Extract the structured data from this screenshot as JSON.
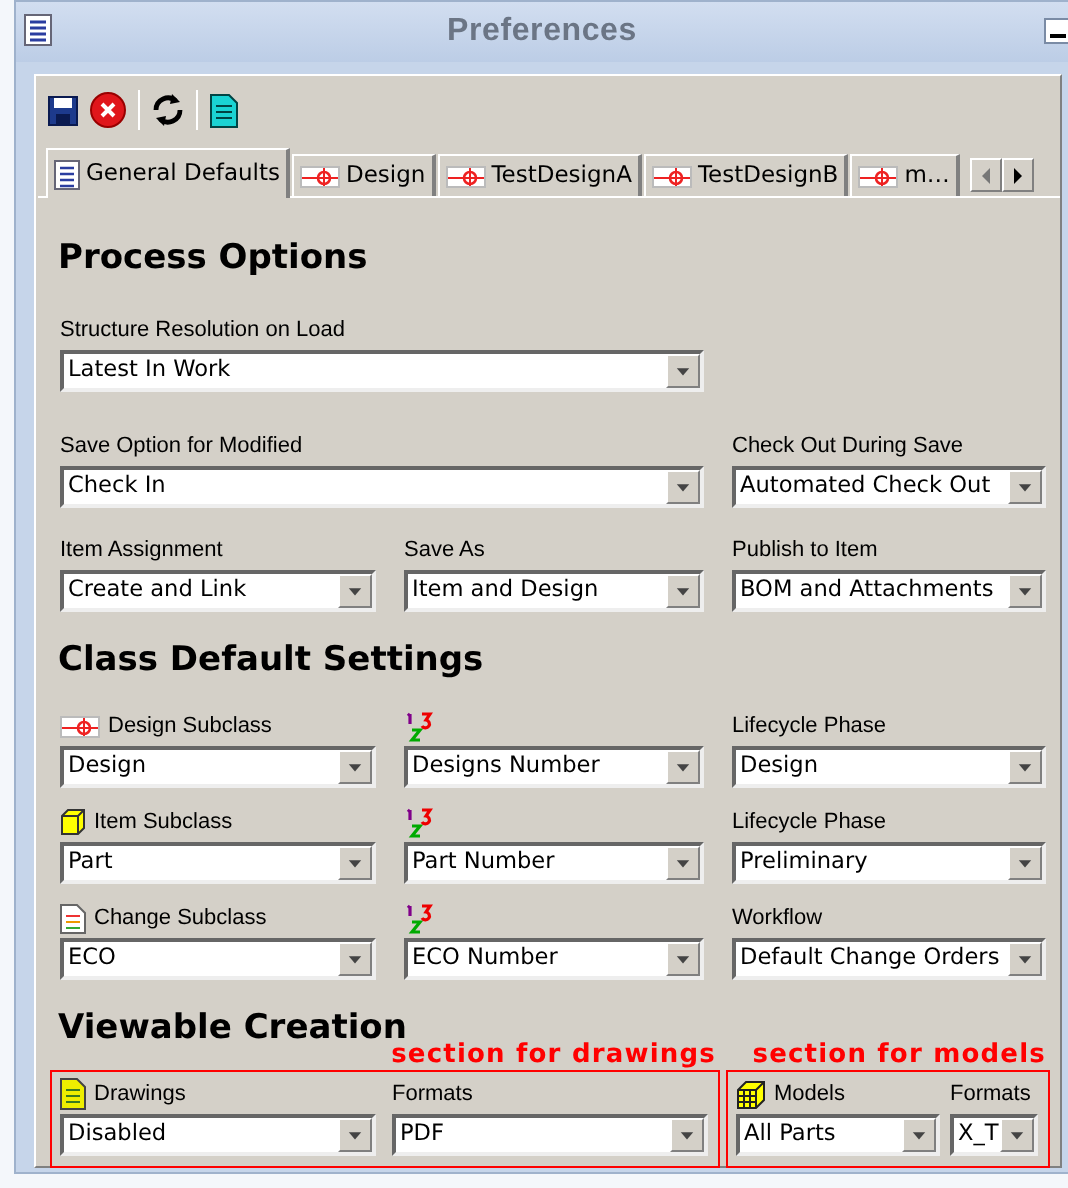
{
  "window": {
    "title": "Preferences"
  },
  "tabs": [
    {
      "label": "General Defaults",
      "kind": "general",
      "selected": true
    },
    {
      "label": "Design",
      "kind": "design",
      "selected": false
    },
    {
      "label": "TestDesignA",
      "kind": "design",
      "selected": false
    },
    {
      "label": "TestDesignB",
      "kind": "design",
      "selected": false
    },
    {
      "label": "m…",
      "kind": "design",
      "selected": false
    }
  ],
  "process_options": {
    "title": "Process Options",
    "fields": [
      {
        "kind": "wide",
        "label": "Structure Resolution on Load",
        "value": "Latest In Work"
      },
      {
        "kind": "wide",
        "label": "Save Option for Modified",
        "value": "Check In"
      },
      {
        "kind": "narrow",
        "label": "Check Out During Save",
        "value": "Automated Check Out"
      },
      {
        "kind": "narrow",
        "label": "Item Assignment",
        "value": "Create and Link"
      },
      {
        "kind": "narrow",
        "label": "Save As",
        "value": "Item and Design"
      },
      {
        "kind": "narrow",
        "label": "Publish to Item",
        "value": "BOM and Attachments"
      }
    ]
  },
  "class_defaults": {
    "title": "Class Default Settings",
    "rows": [
      {
        "subclass": {
          "kind": "design",
          "label": "Design Subclass",
          "value": "Design"
        },
        "number": {
          "value": "Designs Number"
        },
        "phase": {
          "label": "Lifecycle Phase",
          "value": "Design"
        }
      },
      {
        "subclass": {
          "kind": "item",
          "label": "Item Subclass",
          "value": "Part"
        },
        "number": {
          "value": "Part Number"
        },
        "phase": {
          "label": "Lifecycle Phase",
          "value": "Preliminary"
        }
      },
      {
        "subclass": {
          "kind": "change",
          "label": "Change Subclass",
          "value": "ECO"
        },
        "number": {
          "value": "ECO Number"
        },
        "phase": {
          "label": "Workflow",
          "value": "Default Change Orders"
        }
      }
    ]
  },
  "viewable_creation": {
    "title": "Viewable Creation",
    "groups": [
      {
        "kind": "drawings",
        "annotation": "section for drawings",
        "fields": [
          {
            "label": "Drawings",
            "value": "Disabled"
          },
          {
            "label": "Formats",
            "value": "PDF"
          }
        ]
      },
      {
        "kind": "models",
        "annotation": "section for models",
        "fields": [
          {
            "label": "Models",
            "value": "All Parts"
          },
          {
            "label": "Formats",
            "value": "X_T"
          }
        ]
      }
    ]
  }
}
